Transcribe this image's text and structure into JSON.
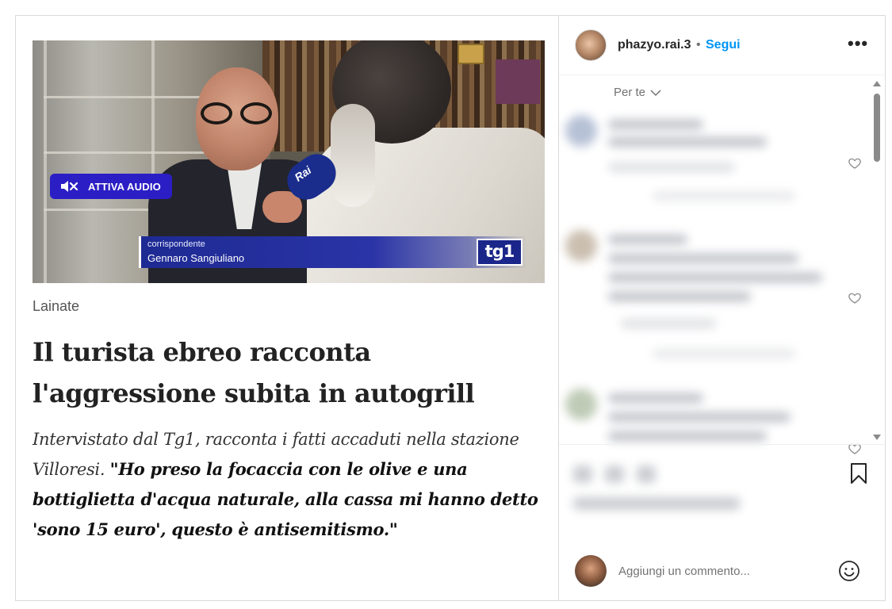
{
  "post": {
    "audio_button_label": "ATTIVA AUDIO",
    "video": {
      "mic_brand": "Rai",
      "caption_role": "corrispondente",
      "caption_name": "Gennaro Sangiuliano",
      "channel_logo": "tg1"
    },
    "location": "Lainate",
    "headline": "Il turista ebreo racconta l'aggressione subita in autogrill",
    "subtitle_intro": "Intervistato dal Tg1, racconta i fatti accaduti nella stazione Villoresi.",
    "quote": "\"Ho preso la focaccia con le olive e una bottiglietta d'acqua naturale, alla cassa mi hanno detto 'sono 15 euro', questo è antisemitismo.\""
  },
  "header": {
    "username": "phazyo.rai.3",
    "separator": "•",
    "follow_label": "Segui",
    "more_label": "•••"
  },
  "feed": {
    "filter_label": "Per te"
  },
  "comment_box": {
    "placeholder": "Aggiungi un commento..."
  },
  "icons": [
    "volume-mute-icon",
    "chevron-down-icon",
    "heart-icon",
    "bookmark-icon",
    "emoji-icon"
  ],
  "colors": {
    "accent": "#0095f6",
    "audio_pill": "#2b1ec4",
    "tg1_blue": "#1a2689"
  }
}
